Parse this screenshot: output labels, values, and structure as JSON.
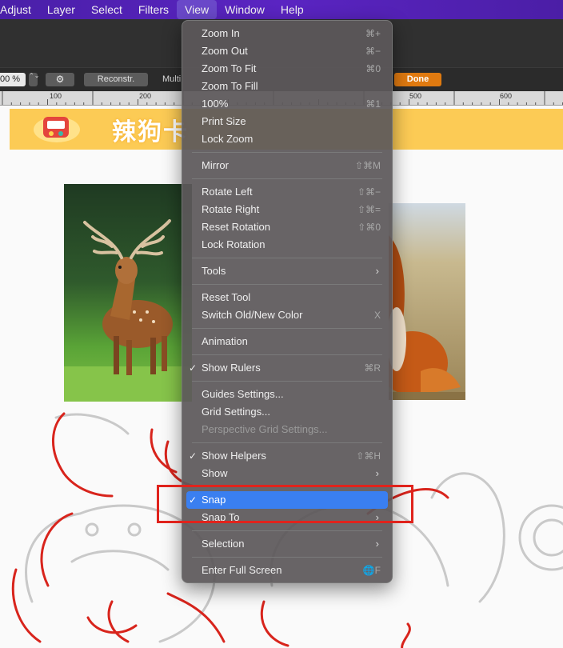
{
  "menubar": {
    "items": [
      "Adjust",
      "Layer",
      "Select",
      "Filters",
      "View",
      "Window",
      "Help"
    ],
    "active": "View"
  },
  "toolbar": {
    "zoom_value": "00 %",
    "reconstruct_label": "Reconstr.",
    "multi_label": "Multi",
    "done_label": "Done"
  },
  "ruler": {
    "labels": [
      "100",
      "200",
      "500",
      "600"
    ]
  },
  "canvas": {
    "banner_text": "辣狗卡"
  },
  "view_menu": {
    "zoom_in": {
      "label": "Zoom In",
      "shortcut": "⌘+"
    },
    "zoom_out": {
      "label": "Zoom Out",
      "shortcut": "⌘−"
    },
    "zoom_to_fit": {
      "label": "Zoom To Fit",
      "shortcut": "⌘0"
    },
    "zoom_to_fill": {
      "label": "Zoom To Fill"
    },
    "actual_size": {
      "label": "100%",
      "shortcut": "⌘1"
    },
    "print_size": {
      "label": "Print Size"
    },
    "lock_zoom": {
      "label": "Lock Zoom"
    },
    "mirror": {
      "label": "Mirror",
      "shortcut": "⇧⌘M"
    },
    "rotate_left": {
      "label": "Rotate Left",
      "shortcut": "⇧⌘−"
    },
    "rotate_right": {
      "label": "Rotate Right",
      "shortcut": "⇧⌘="
    },
    "reset_rotation": {
      "label": "Reset Rotation",
      "shortcut": "⇧⌘0"
    },
    "lock_rotation": {
      "label": "Lock Rotation"
    },
    "tools": {
      "label": "Tools"
    },
    "reset_tool": {
      "label": "Reset Tool"
    },
    "switch_color": {
      "label": "Switch Old/New Color",
      "shortcut": "X"
    },
    "animation": {
      "label": "Animation"
    },
    "show_rulers": {
      "label": "Show Rulers",
      "shortcut": "⌘R",
      "checked": true
    },
    "guides_settings": {
      "label": "Guides Settings..."
    },
    "grid_settings": {
      "label": "Grid Settings..."
    },
    "perspective_grid_settings": {
      "label": "Perspective Grid Settings...",
      "disabled": true
    },
    "show_helpers": {
      "label": "Show Helpers",
      "shortcut": "⇧⌘H",
      "checked": true
    },
    "show": {
      "label": "Show"
    },
    "snap": {
      "label": "Snap",
      "checked": true,
      "highlighted": true
    },
    "snap_to": {
      "label": "Snap To"
    },
    "selection": {
      "label": "Selection"
    },
    "enter_full_screen": {
      "label": "Enter Full Screen",
      "shortcut": "🌐F"
    }
  },
  "glyphs": {
    "check": "✓",
    "arrow": "›",
    "gear": "⚙",
    "stepper": "⌃⌄"
  },
  "colors": {
    "menubar": "#5a24c2",
    "highlight": "#3a7ff0",
    "done_button": "#e07a10",
    "annotation": "#e0231c",
    "banner": "#fccb55"
  }
}
